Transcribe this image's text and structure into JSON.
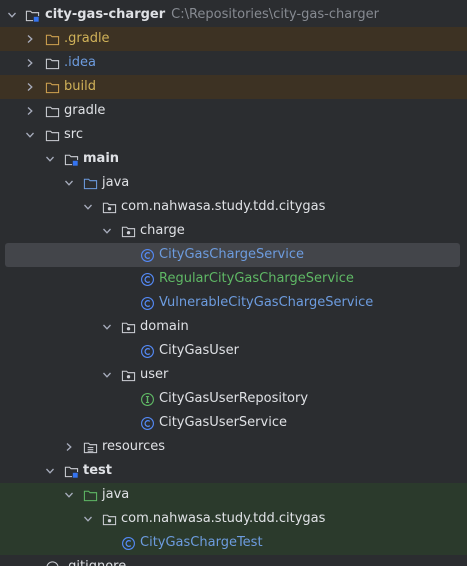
{
  "project": {
    "name": "city-gas-charger",
    "path": "C:\\Repositories\\city-gas-charger"
  },
  "tree": {
    "gradle_hidden": ".gradle",
    "idea": ".idea",
    "build": "build",
    "gradle": "gradle",
    "src": "src",
    "main": "main",
    "main_java": "java",
    "main_package": "com.nahwasa.study.tdd.citygas",
    "charge": "charge",
    "charge_service": "CityGasChargeService",
    "regular_service": "RegularCityGasChargeService",
    "vulnerable_service": "VulnerableCityGasChargeService",
    "domain": "domain",
    "user_class": "CityGasUser",
    "user_pkg": "user",
    "user_repository": "CityGasUserRepository",
    "user_service": "CityGasUserService",
    "resources": "resources",
    "test": "test",
    "test_java": "java",
    "test_package": "com.nahwasa.study.tdd.citygas",
    "test_class": "CityGasChargeTest",
    "gitignore": ".gitignore"
  },
  "colors": {
    "background": "#2b2d30",
    "selection": "#43454a",
    "excluded_row": "#3d3223",
    "test_row": "#2b3a2c",
    "excluded_text": "#d0b259",
    "vcs_modified": "#6d9cdf",
    "vcs_added": "#5fb865"
  },
  "icons": {
    "expanded": "chevron-down-icon",
    "collapsed": "chevron-right-icon",
    "folder": "folder-icon",
    "module": "module-folder-icon",
    "package": "package-icon",
    "class": "class-icon",
    "interface": "interface-icon",
    "resources": "resources-folder-icon",
    "file": "file-icon"
  }
}
